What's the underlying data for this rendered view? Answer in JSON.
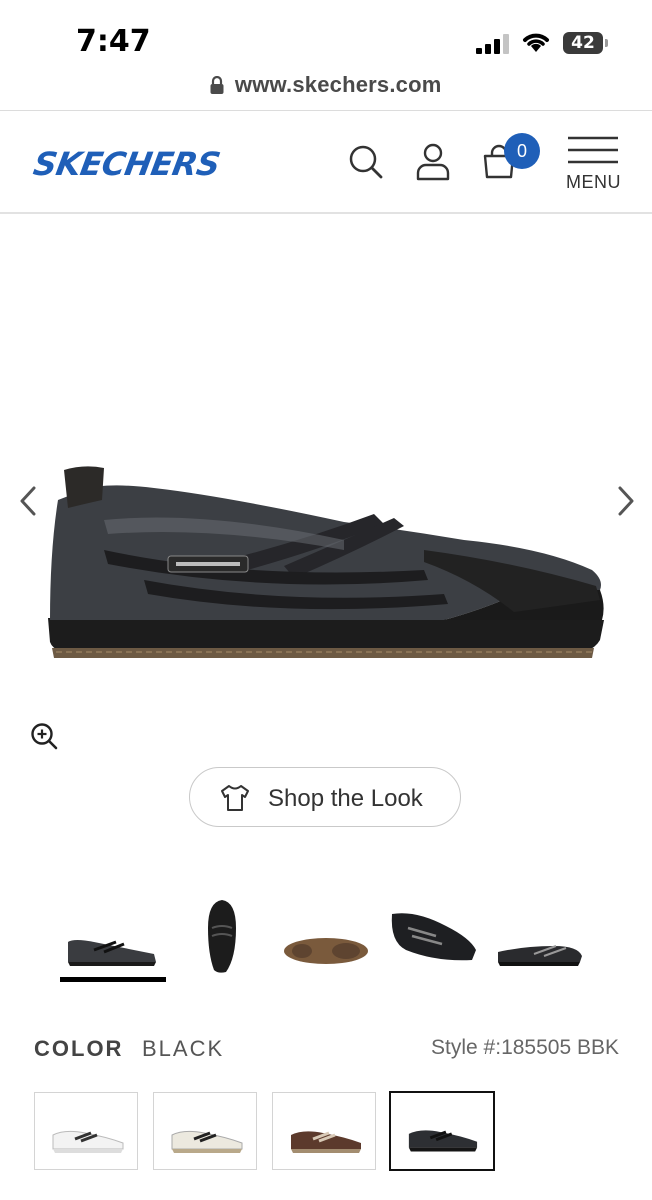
{
  "status_bar": {
    "time": "7:47",
    "battery": "42"
  },
  "browser": {
    "url": "www.skechers.com"
  },
  "header": {
    "logo_text": "SKECHERS",
    "cart_count": "0",
    "menu_label": "MENU"
  },
  "product": {
    "shop_the_look_label": "Shop the Look",
    "color_label": "COLOR",
    "color_value": "BLACK",
    "style_number": "Style #:185505 BBK",
    "swatches": [
      "white",
      "off-white",
      "brown",
      "black"
    ],
    "selected_swatch": "black"
  },
  "colors": {
    "brand_blue": "#1f5fb8",
    "text_dark": "#222222",
    "border": "#c9c9c9"
  },
  "icons": [
    "lock-icon",
    "search-icon",
    "account-icon",
    "cart-icon",
    "menu-icon",
    "chevron-left-icon",
    "chevron-right-icon",
    "zoom-in-icon",
    "shirt-icon"
  ]
}
